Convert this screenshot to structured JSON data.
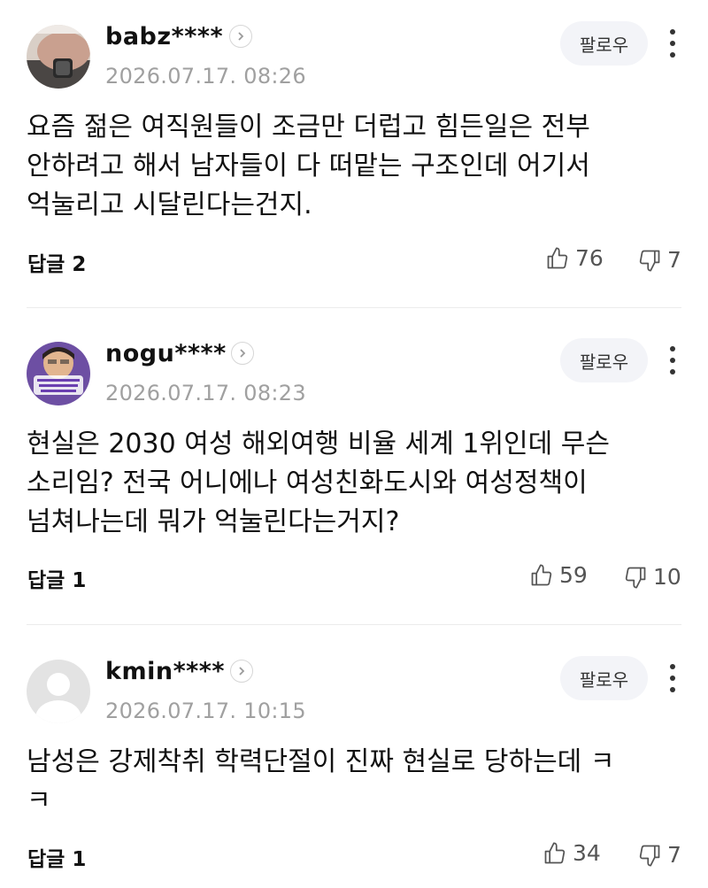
{
  "follow_label": "팔로우",
  "comments": [
    {
      "username": "babz****",
      "timestamp": "2026.07.17. 08:26",
      "body": "요즘 젊은 여직원들이 조금만 더럽고 힘든일은 전부\n안하려고 해서 남자들이 다 떠맡는 구조인데 어기서\n억눌리고 시달린다는건지.",
      "reply_label": "답글",
      "reply_count": "2",
      "likes": "76",
      "dislikes": "7",
      "avatar_icon": "wrist-watch-photo"
    },
    {
      "username": "nogu****",
      "timestamp": "2026.07.17. 08:23",
      "body": "현실은 2030 여성 해외여행 비율 세계 1위인데 무슨\n소리임? 전국 어니에나 여성친화도시와 여성정책이\n넘쳐나는데 뭐가 억눌린다는거지?",
      "reply_label": "답글",
      "reply_count": "1",
      "likes": "59",
      "dislikes": "10",
      "avatar_icon": "person-photo"
    },
    {
      "username": "kmin****",
      "timestamp": "2026.07.17. 10:15",
      "body": "남성은 강제착취 학력단절이 진짜 현실로 당하는데 ㅋ\nㅋ",
      "reply_label": "답글",
      "reply_count": "1",
      "likes": "34",
      "dislikes": "7",
      "avatar_icon": "default-user"
    }
  ],
  "colors": {
    "text": "#111111",
    "meta": "#a0a0a0",
    "follow_bg": "#f3f4f8",
    "divider": "#ececec"
  }
}
